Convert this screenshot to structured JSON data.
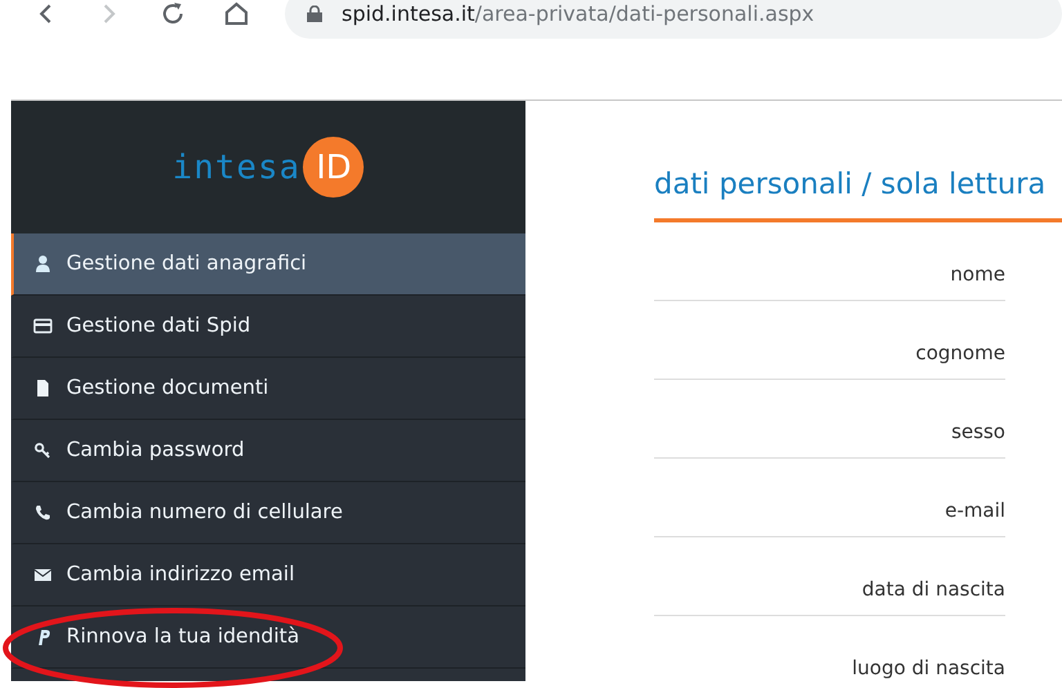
{
  "browser": {
    "url_host": "spid.intesa.it",
    "url_path": "/area-privata/dati-personali.aspx",
    "forward_disabled": true
  },
  "sidebar": {
    "logo": {
      "text": "intesa",
      "badge": "ID"
    },
    "items": [
      {
        "kind": "user",
        "label": "Gestione dati anagrafici",
        "selected": true
      },
      {
        "kind": "card",
        "label": "Gestione dati Spid",
        "selected": false
      },
      {
        "kind": "document",
        "label": "Gestione documenti",
        "selected": false
      },
      {
        "kind": "key",
        "label": "Cambia password",
        "selected": false
      },
      {
        "kind": "phone",
        "label": "Cambia numero di cellulare",
        "selected": false
      },
      {
        "kind": "envelope",
        "label": "Cambia indirizzo email",
        "selected": false
      },
      {
        "kind": "p",
        "label": "Rinnova la tua idendità",
        "selected": false
      }
    ]
  },
  "main": {
    "title": "dati personali / sola lettura",
    "fields": [
      {
        "label": "nome"
      },
      {
        "label": "cognome"
      },
      {
        "label": "sesso"
      },
      {
        "label": "e-mail"
      },
      {
        "label": "data di nascita"
      },
      {
        "label": "luogo di nascita"
      }
    ]
  }
}
